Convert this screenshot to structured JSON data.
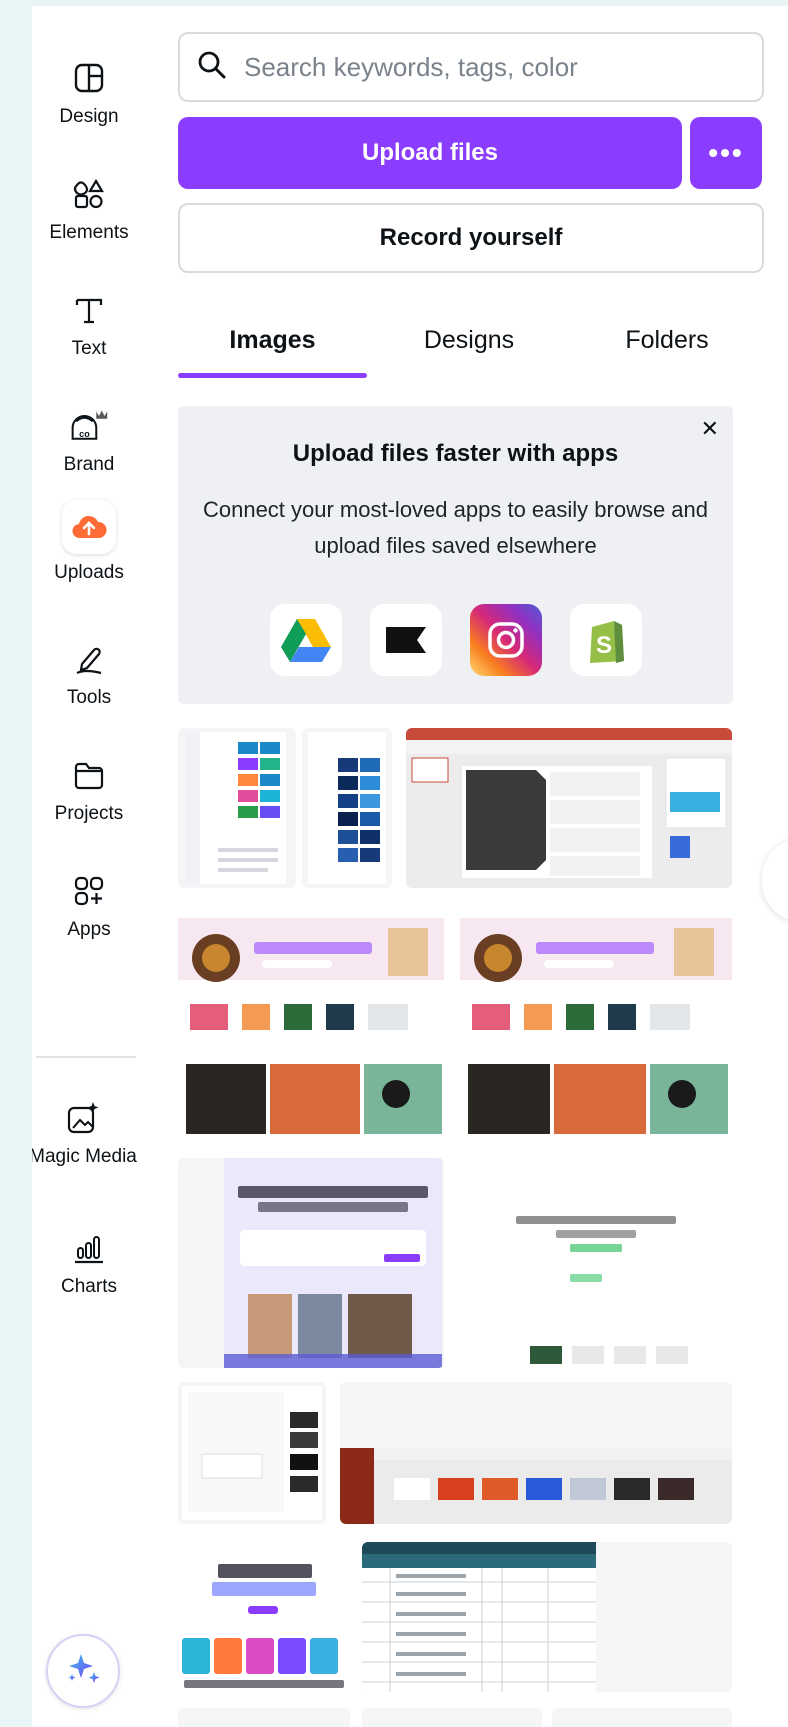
{
  "rail": {
    "items": [
      {
        "label": "Design",
        "icon": "design-icon"
      },
      {
        "label": "Elements",
        "icon": "elements-icon"
      },
      {
        "label": "Text",
        "icon": "text-icon"
      },
      {
        "label": "Brand",
        "icon": "brand-icon"
      },
      {
        "label": "Uploads",
        "icon": "upload-cloud-icon",
        "active": true
      },
      {
        "label": "Tools",
        "icon": "pen-tool-icon"
      },
      {
        "label": "Projects",
        "icon": "folder-icon"
      },
      {
        "label": "Apps",
        "icon": "apps-icon"
      },
      {
        "label": "Magic Media",
        "icon": "magic-media-icon"
      },
      {
        "label": "Charts",
        "icon": "charts-icon"
      }
    ]
  },
  "search": {
    "placeholder": "Search keywords, tags, color"
  },
  "buttons": {
    "upload": "Upload files",
    "more": "•••",
    "record": "Record yourself"
  },
  "tabs": [
    {
      "label": "Images",
      "active": true
    },
    {
      "label": "Designs"
    },
    {
      "label": "Folders"
    }
  ],
  "promo": {
    "title": "Upload files faster with apps",
    "description": "Connect your most-loved apps to easily browse and upload files saved elsewhere",
    "close": "✕",
    "apps": [
      "google-drive-icon",
      "klaviyo-flag-icon",
      "instagram-icon",
      "shopify-icon"
    ]
  },
  "colors": {
    "accent": "#8b3dff",
    "brand_orange": "#ff6b35"
  }
}
